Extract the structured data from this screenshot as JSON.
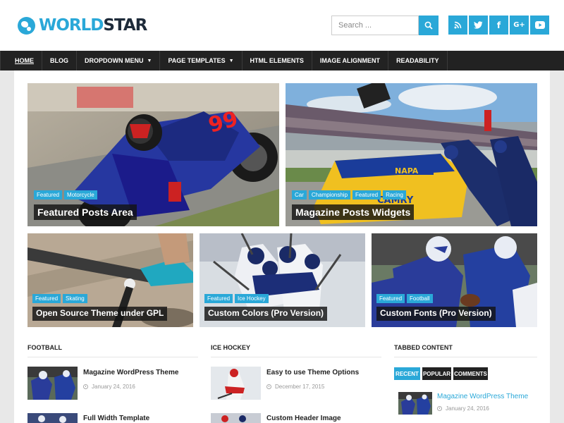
{
  "site": {
    "logo_part1": "WORLD",
    "logo_part2": "STAR"
  },
  "search": {
    "placeholder": "Search ..."
  },
  "social": [
    {
      "name": "rss-icon",
      "glyph": "◉"
    },
    {
      "name": "twitter-icon",
      "glyph": "t"
    },
    {
      "name": "facebook-icon",
      "glyph": "f"
    },
    {
      "name": "google-plus-icon",
      "glyph": "G+"
    },
    {
      "name": "youtube-icon",
      "glyph": "▶"
    }
  ],
  "nav": [
    {
      "label": "HOME",
      "active": true
    },
    {
      "label": "BLOG"
    },
    {
      "label": "DROPDOWN MENU",
      "dropdown": true
    },
    {
      "label": "PAGE TEMPLATES",
      "dropdown": true
    },
    {
      "label": "HTML ELEMENTS"
    },
    {
      "label": "IMAGE ALIGNMENT"
    },
    {
      "label": "READABILITY"
    }
  ],
  "featured": [
    {
      "title": "Featured Posts Area",
      "tags": [
        "Featured",
        "Motorcycle"
      ]
    },
    {
      "title": "Magazine Posts Widgets",
      "tags": [
        "Car",
        "Championship",
        "Featured",
        "Racing"
      ]
    },
    {
      "title": "Open Source Theme under GPL",
      "tags": [
        "Featured",
        "Skating"
      ]
    },
    {
      "title": "Custom Colors (Pro Version)",
      "tags": [
        "Featured",
        "Ice Hockey"
      ]
    },
    {
      "title": "Custom Fonts (Pro Version)",
      "tags": [
        "Featured",
        "Football"
      ]
    }
  ],
  "sections": {
    "football": {
      "heading": "FOOTBALL",
      "posts": [
        {
          "title": "Magazine WordPress Theme",
          "date": "January 24, 2016"
        },
        {
          "title": "Full Width Template"
        }
      ]
    },
    "icehockey": {
      "heading": "ICE HOCKEY",
      "posts": [
        {
          "title": "Easy to use Theme Options",
          "date": "December 17, 2015"
        },
        {
          "title": "Custom Header Image"
        }
      ]
    },
    "tabbed": {
      "heading": "TABBED CONTENT",
      "tabs": [
        {
          "label": "RECENT",
          "active": true
        },
        {
          "label": "POPULAR"
        },
        {
          "label": "COMMENTS"
        }
      ],
      "post": {
        "title": "Magazine WordPress Theme",
        "date": "January 24, 2016"
      }
    }
  },
  "colors": {
    "accent": "#2aa8d8",
    "nav_bg": "#222222",
    "page_bg": "#e8e8e8"
  }
}
